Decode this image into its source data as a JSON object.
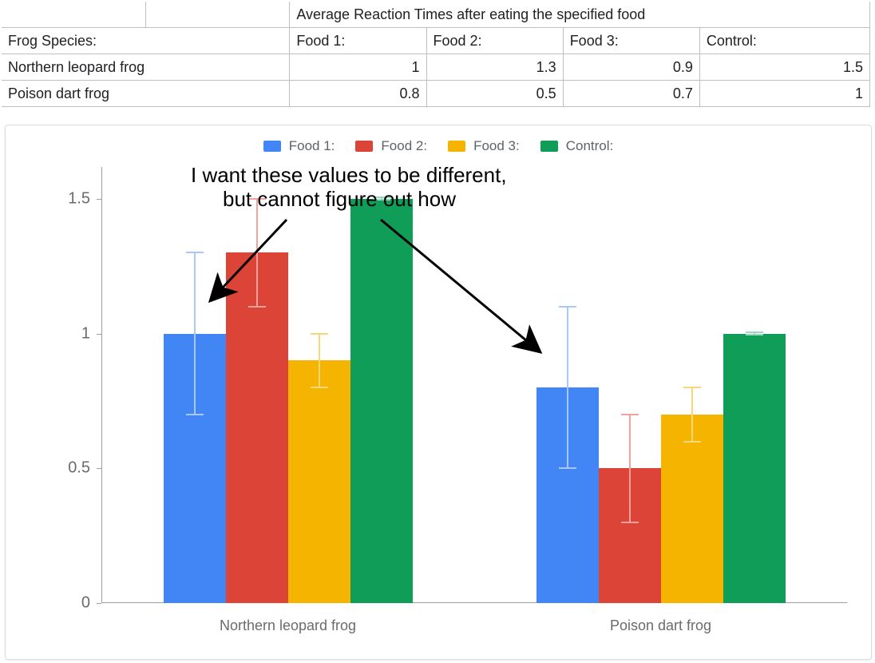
{
  "table": {
    "merged_header": "Average Reaction Times after eating the specified food",
    "row_header": "Frog Species:",
    "col_headers": [
      "Food 1:",
      "Food 2:",
      "Food 3:",
      "Control:"
    ],
    "species": [
      "Northern leopard frog",
      "Poison dart frog"
    ],
    "values": [
      [
        "1",
        "1.3",
        "0.9",
        "1.5"
      ],
      [
        "0.8",
        "0.5",
        "0.7",
        "1"
      ]
    ]
  },
  "legend": {
    "items": [
      "Food 1:",
      "Food 2:",
      "Food 3:",
      "Control:"
    ]
  },
  "colors": {
    "series": [
      "#4285F4",
      "#DB4437",
      "#F4B400",
      "#0F9D58"
    ],
    "error": [
      "#a8c7fa",
      "#f1a39b",
      "#f6d878",
      "#9ad6be"
    ]
  },
  "annotation": {
    "line1": "I want these values to be different,",
    "line2": "but cannot figure out how"
  },
  "chart_data": {
    "type": "bar",
    "categories": [
      "Northern leopard frog",
      "Poison dart frog"
    ],
    "series": [
      {
        "name": "Food 1:",
        "values": [
          1.0,
          0.8
        ],
        "error": [
          0.3,
          0.3
        ]
      },
      {
        "name": "Food 2:",
        "values": [
          1.3,
          0.5
        ],
        "error": [
          0.2,
          0.2
        ]
      },
      {
        "name": "Food 3:",
        "values": [
          0.9,
          0.7
        ],
        "error": [
          0.1,
          0.1
        ]
      },
      {
        "name": "Control:",
        "values": [
          1.5,
          1.0
        ],
        "error": [
          0.005,
          0.005
        ]
      }
    ],
    "ylim": [
      0,
      1.6
    ],
    "yticks": [
      0,
      0.5,
      1,
      1.5
    ],
    "xlabel": "",
    "ylabel": "",
    "title": "",
    "legend_position": "top"
  }
}
